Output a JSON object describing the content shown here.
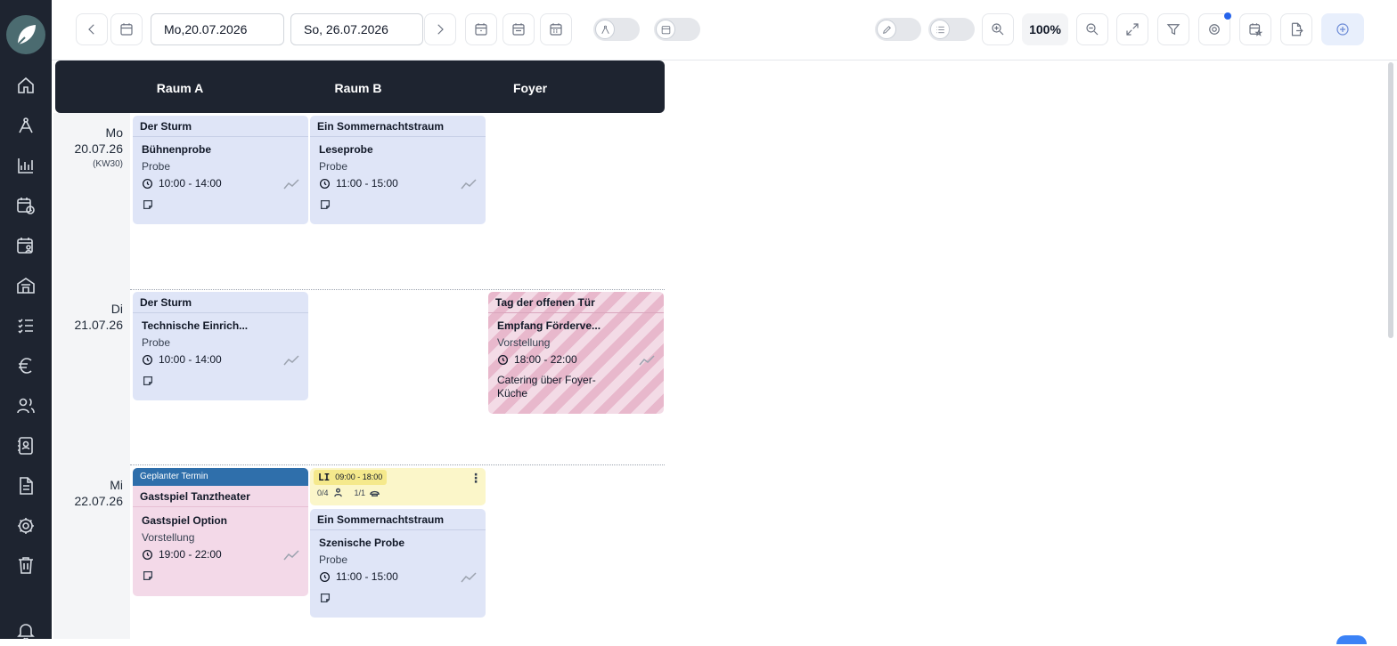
{
  "toolbar": {
    "date_from": "Mo,20.07.2026",
    "date_to": "So, 26.07.2026",
    "zoom": "100%"
  },
  "columns": [
    "Raum A",
    "Raum B",
    "Foyer"
  ],
  "days": [
    {
      "weekday": "Mo",
      "date": "20.07.26",
      "week": "(KW30)"
    },
    {
      "weekday": "Di",
      "date": "21.07.26"
    },
    {
      "weekday": "Mi",
      "date": "22.07.26"
    }
  ],
  "events": {
    "e1": {
      "production": "Der Sturm",
      "title": "Bühnenprobe",
      "type": "Probe",
      "time": "10:00 - 14:00"
    },
    "e2": {
      "production": "Ein Sommernachtstraum",
      "title": "Leseprobe",
      "type": "Probe",
      "time": "11:00 - 15:00"
    },
    "e3": {
      "production": "Der Sturm",
      "title": "Technische Einrich...",
      "type": "Probe",
      "time": "10:00 - 14:00"
    },
    "e4": {
      "production": "Tag der offenen Tür",
      "title": "Empfang Förderve...",
      "type": "Vorstellung",
      "time": "18:00 - 22:00",
      "desc": "Catering über Foyer-Küche"
    },
    "e5": {
      "band": "Geplanter Termin",
      "production": "Gastspiel Tanztheater",
      "title": "Gastspiel Option",
      "type": "Vorstellung",
      "time": "19:00 - 22:00"
    },
    "e6": {
      "production": "Ein Sommernachtstraum",
      "title": "Szenische Probe",
      "type": "Probe",
      "time": "11:00 - 15:00"
    }
  },
  "li_card": {
    "code": "LI",
    "time": "09:00 - 18:00",
    "persons": "0/4",
    "items": "1/1"
  },
  "colors": {
    "sidebar": "#1e2430",
    "event_blue": "#dfe5f7",
    "event_pink": "#f3d9e8",
    "planned": "#2f6fab",
    "li_yellow": "#fbf6c9",
    "accent": "#2563eb"
  }
}
